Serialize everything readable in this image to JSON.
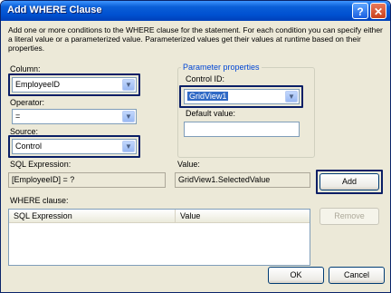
{
  "window": {
    "title": "Add WHERE Clause"
  },
  "description": "Add one or more conditions to the WHERE clause for the statement. For each condition you can specify either a literal value or a parameterized value. Parameterized values get their values at runtime based on their properties.",
  "column": {
    "label": "Column:",
    "value": "EmployeeID"
  },
  "operator": {
    "label": "Operator:",
    "value": "="
  },
  "source": {
    "label": "Source:",
    "value": "Control"
  },
  "parameter_properties": {
    "title": "Parameter properties",
    "control_id": {
      "label": "Control ID:",
      "value": "GridView1"
    },
    "default_value": {
      "label": "Default value:",
      "value": ""
    }
  },
  "sql_expression": {
    "label": "SQL Expression:",
    "value": "[EmployeeID] = ?"
  },
  "value": {
    "label": "Value:",
    "value": "GridView1.SelectedValue"
  },
  "buttons": {
    "add": "Add",
    "remove": "Remove",
    "ok": "OK",
    "cancel": "Cancel"
  },
  "where_clause": {
    "label": "WHERE clause:",
    "columns": [
      "SQL Expression",
      "Value"
    ]
  },
  "icons": {
    "help": "?",
    "close": "✕",
    "dropdown": "▼"
  },
  "colors": {
    "highlight_border": "#0a1f66",
    "group_title": "#0046d5",
    "titlebar": "#0050d0"
  }
}
